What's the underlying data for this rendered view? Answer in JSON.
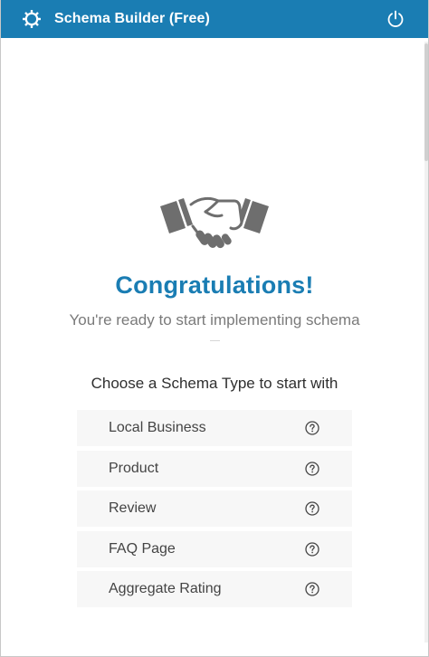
{
  "app": {
    "title": "Schema Builder (Free)",
    "logo_icon": "gear-ring-icon",
    "power_icon": "power-icon",
    "accent": "#1a7db3"
  },
  "hero": {
    "illustration": "handshake-icon",
    "heading": "Congratulations!",
    "subtitle": "You're ready to start implementing schema"
  },
  "types_section": {
    "heading": "Choose a Schema Type to start with",
    "items": [
      {
        "label": "Local Business",
        "icon": "help-circle-icon"
      },
      {
        "label": "Product",
        "icon": "help-circle-icon"
      },
      {
        "label": "Review",
        "icon": "help-circle-icon"
      },
      {
        "label": "FAQ Page",
        "icon": "help-circle-icon"
      },
      {
        "label": "Aggregate Rating",
        "icon": "help-circle-icon"
      }
    ]
  }
}
